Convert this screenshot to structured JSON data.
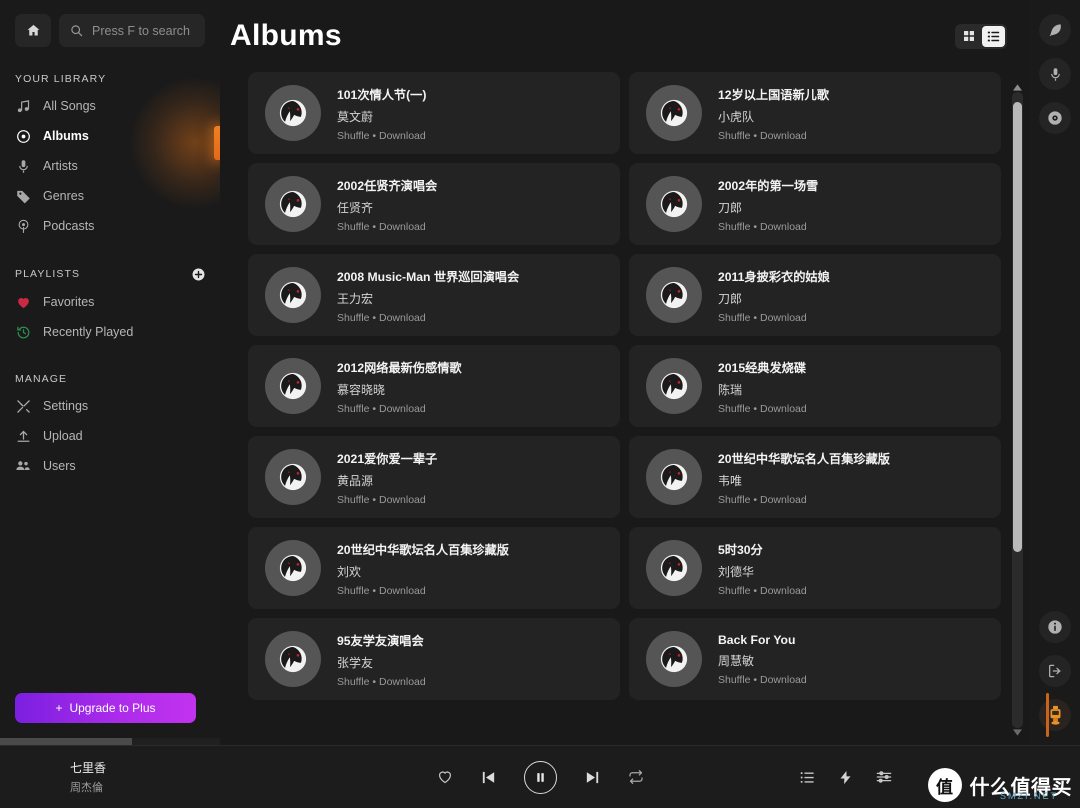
{
  "sidebar": {
    "home_label": "Home",
    "search": {
      "placeholder": "Press F to search"
    },
    "library_heading": "YOUR LIBRARY",
    "library_items": [
      {
        "label": "All Songs",
        "icon": "music-note-icon"
      },
      {
        "label": "Albums",
        "icon": "disc-icon"
      },
      {
        "label": "Artists",
        "icon": "microphone-icon"
      },
      {
        "label": "Genres",
        "icon": "tag-icon"
      },
      {
        "label": "Podcasts",
        "icon": "podcast-icon"
      }
    ],
    "active_item": "Albums",
    "playlists_heading": "PLAYLISTS",
    "playlist_items": [
      {
        "label": "Favorites",
        "icon": "heart-icon"
      },
      {
        "label": "Recently Played",
        "icon": "history-icon"
      }
    ],
    "manage_heading": "MANAGE",
    "manage_items": [
      {
        "label": "Settings",
        "icon": "tools-icon"
      },
      {
        "label": "Upload",
        "icon": "upload-icon"
      },
      {
        "label": "Users",
        "icon": "users-icon"
      }
    ],
    "upgrade_label": "Upgrade to Plus",
    "upgrade_plus": "+"
  },
  "header": {
    "title": "Albums",
    "view_grid": "grid-view",
    "view_list": "list-view",
    "active_view": "list-view"
  },
  "albums": [
    {
      "title": "101次情人节(一)",
      "artist": "莫文蔚",
      "actions": "Shuffle • Download"
    },
    {
      "title": "12岁以上国语新儿歌",
      "artist": "小虎队",
      "actions": "Shuffle • Download"
    },
    {
      "title": "2002任贤齐演唱会",
      "artist": "任贤齐",
      "actions": "Shuffle • Download"
    },
    {
      "title": "2002年的第一场雪",
      "artist": "刀郎",
      "actions": "Shuffle • Download"
    },
    {
      "title": "2008 Music-Man 世界巡回演唱会",
      "artist": "王力宏",
      "actions": "Shuffle • Download"
    },
    {
      "title": "2011身披彩衣的姑娘",
      "artist": "刀郎",
      "actions": "Shuffle • Download"
    },
    {
      "title": "2012网络最新伤感情歌",
      "artist": "慕容晓晓",
      "actions": "Shuffle • Download"
    },
    {
      "title": "2015经典发烧碟",
      "artist": "陈瑞",
      "actions": "Shuffle • Download"
    },
    {
      "title": "2021爱你爱一辈子",
      "artist": "黄品源",
      "actions": "Shuffle • Download"
    },
    {
      "title": "20世纪中华歌坛名人百集珍藏版",
      "artist": "韦唯",
      "actions": "Shuffle • Download"
    },
    {
      "title": "20世纪中华歌坛名人百集珍藏版",
      "artist": "刘欢",
      "actions": "Shuffle • Download"
    },
    {
      "title": "5时30分",
      "artist": "刘德华",
      "actions": "Shuffle • Download"
    },
    {
      "title": "95友学友演唱会",
      "artist": "张学友",
      "actions": "Shuffle • Download"
    },
    {
      "title": "Back For You",
      "artist": "周慧敏",
      "actions": "Shuffle • Download"
    }
  ],
  "rail": {
    "top_icons": [
      {
        "name": "feather-icon"
      },
      {
        "name": "microphone-icon"
      },
      {
        "name": "disc-icon"
      }
    ],
    "bottom_icons": [
      {
        "name": "info-icon"
      },
      {
        "name": "logout-icon"
      },
      {
        "name": "avatar"
      }
    ]
  },
  "player": {
    "track_title": "七里香",
    "track_artist": "周杰倫",
    "controls": [
      "favorite-icon",
      "previous-icon",
      "pause-icon",
      "next-icon",
      "repeat-icon"
    ],
    "right_icons": [
      "queue-icon",
      "bolt-icon",
      "equalizer-icon"
    ]
  },
  "watermark": {
    "badge": "值",
    "text": "什么值得买",
    "sub": "SMZI.NET"
  },
  "colors": {
    "accent_orange": "#f08021",
    "upgrade_purple": "#aa2bea",
    "favorite_red": "#c92a43",
    "recent_green": "#2f8f52",
    "card_bg": "#232323",
    "sidebar_bg": "#1a1a1a",
    "main_bg": "#191919"
  }
}
